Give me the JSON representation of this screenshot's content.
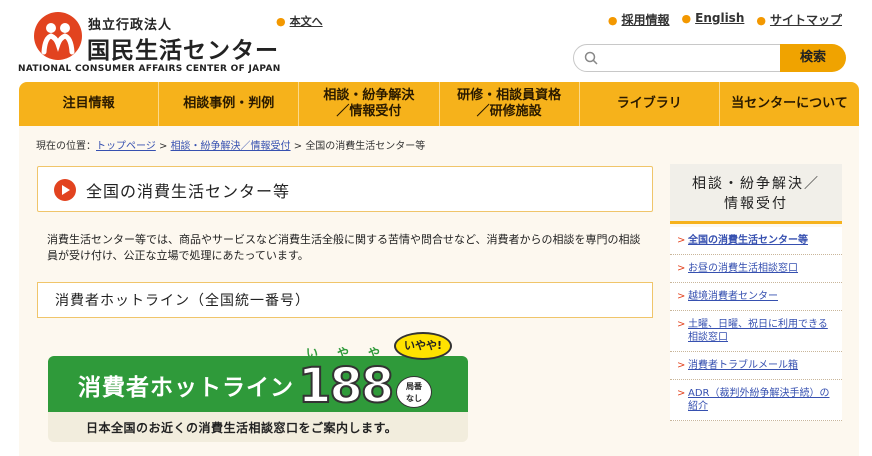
{
  "header": {
    "org_sub": "独立行政法人",
    "org_name": "国民生活センター",
    "org_en": "NATIONAL CONSUMER AFFAIRS CENTER OF JAPAN",
    "skip_link": "本文へ",
    "util_links": [
      "採用情報",
      "English",
      "サイトマップ"
    ],
    "search_placeholder": "",
    "search_button": "検索"
  },
  "gnav": [
    "注目情報",
    "相談事例・判例",
    "相談・紛争解決\n／情報受付",
    "研修・相談員資格\n／研修施設",
    "ライブラリ",
    "当センターについて"
  ],
  "breadcrumb": {
    "prefix": "現在の位置：",
    "links": [
      "トップページ",
      "相談・紛争解決／情報受付"
    ],
    "current": "全国の消費生活センター等",
    "sep": " > "
  },
  "main": {
    "title": "全国の消費生活センター等",
    "lead": "消費生活センター等では、商品やサービスなど消費生活全般に関する苦情や問合せなど、消費者からの相談を専門の相談員が受け付け、公正な立場で処理にあたっています。",
    "subtitle": "消費者ホットライン（全国統一番号）"
  },
  "hotline": {
    "label": "消費者ホットライン",
    "number": "188",
    "ruby": "いやや",
    "bubble": "いやや!",
    "tag": "局番\nなし",
    "sub": "日本全国のお近くの消費生活相談窓口をご案内します。"
  },
  "side": {
    "heading": "相談・紛争解決／\n情報受付",
    "items": [
      "全国の消費生活センター等",
      "お昼の消費生活相談窓口",
      "越境消費者センター",
      "土曜、日曜、祝日に利用できる相談窓口",
      "消費者トラブルメール箱",
      "ADR（裁判外紛争解決手続）の紹介"
    ]
  },
  "colors": {
    "brand_red": "#e2431f",
    "nav_orange": "#f6b21b",
    "hotline_green": "#2f9a3a",
    "link_blue": "#3650b0"
  }
}
